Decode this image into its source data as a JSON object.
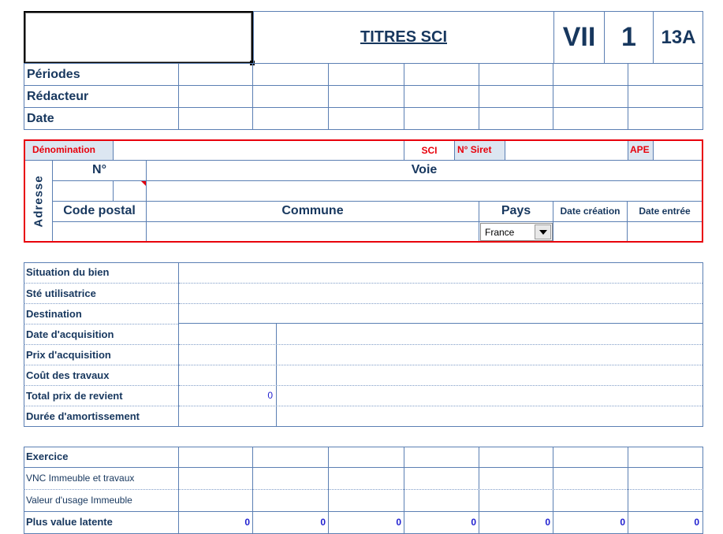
{
  "header": {
    "title": "TITRES SCI",
    "code1": "VII",
    "code2": "1",
    "code3": "13A"
  },
  "meta_rows": [
    "Périodes",
    "Rédacteur",
    "Date"
  ],
  "company": {
    "denomination_label": "Dénomination",
    "sci_label": "SCI",
    "siret_label": "N° Siret",
    "ape_label": "APE",
    "adresse_label": "Adresse",
    "numero_label": "N°",
    "voie_label": "Voie",
    "code_postal_label": "Code postal",
    "commune_label": "Commune",
    "pays_label": "Pays",
    "date_creation_label": "Date création",
    "date_entree_label": "Date entrée",
    "pays_value": "France"
  },
  "bien": {
    "rows": [
      "Situation du bien",
      "Sté utilisatrice",
      "Destination",
      "Date d'acquisition",
      "Prix d'acquisition",
      "Coût des travaux",
      "Total prix de revient",
      "Durée d'amortissement"
    ],
    "total_value": "0"
  },
  "exercice": {
    "exercice_label": "Exercice",
    "vnc_label": "VNC Immeuble et travaux",
    "valeur_label": "Valeur d'usage Immeuble",
    "plus_value_label": "Plus value latente",
    "plus_values": [
      "0",
      "0",
      "0",
      "0",
      "0",
      "0",
      "0"
    ]
  },
  "colors": {
    "accent_red": "#e8000b",
    "text_blue": "#17375e",
    "grid": "#5b7fb3",
    "number_blue": "#1f1fd0"
  },
  "icons": {
    "dropdown": "triangle-down-icon"
  }
}
